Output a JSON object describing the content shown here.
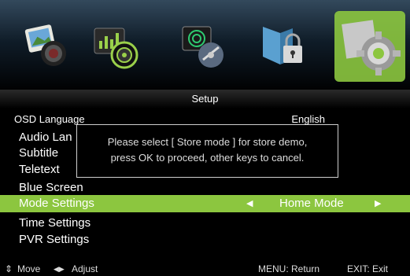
{
  "icons": [
    {
      "name": "picture-icon"
    },
    {
      "name": "sound-icon"
    },
    {
      "name": "channel-icon"
    },
    {
      "name": "lock-icon"
    },
    {
      "name": "setup-icon",
      "selected": true
    }
  ],
  "title": "Setup",
  "menu": {
    "osd_language_label": "OSD Language",
    "osd_language_value": "English",
    "audio_language_label": "Audio Lan",
    "subtitle_label": "Subtitle",
    "teletext_label": "Teletext",
    "blue_screen_label": "Blue Screen",
    "mode_settings_label": "Mode Settings",
    "mode_settings_value": "Home Mode",
    "time_settings_label": "Time Settings",
    "pvr_settings_label": "PVR Settings"
  },
  "dialog": {
    "line1": "Please select [ Store mode ] for store demo,",
    "line2": "press OK to proceed, other keys to cancel."
  },
  "footer": {
    "move": "Move",
    "adjust": "Adjust",
    "menu": "MENU: Return",
    "exit": "EXIT: Exit"
  },
  "colors": {
    "highlight": "#8cc63f",
    "background": "#000000"
  }
}
